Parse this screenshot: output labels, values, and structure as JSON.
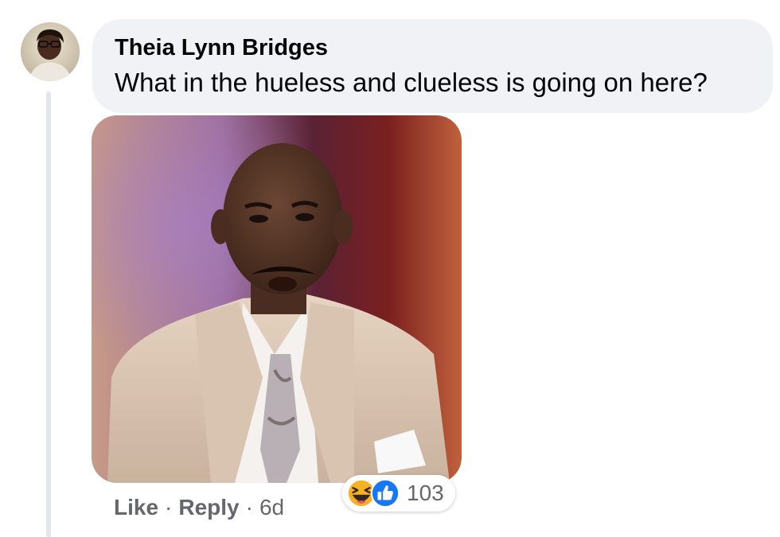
{
  "comment": {
    "author": "Theia Lynn Bridges",
    "text": "What in the hueless and clueless is going on here?",
    "avatar_icon": "profile-photo"
  },
  "media": {
    "type": "gif-image"
  },
  "actions": {
    "like_label": "Like",
    "separator": "·",
    "reply_label": "Reply",
    "age": "6d"
  },
  "reactions": {
    "icons": [
      "haha-icon",
      "like-icon"
    ],
    "count": "103"
  },
  "colors": {
    "bubble": "#f0f2f5",
    "meta_text": "#65676b",
    "like_blue": "#1877f2",
    "haha_yellow": "#f7b125"
  }
}
